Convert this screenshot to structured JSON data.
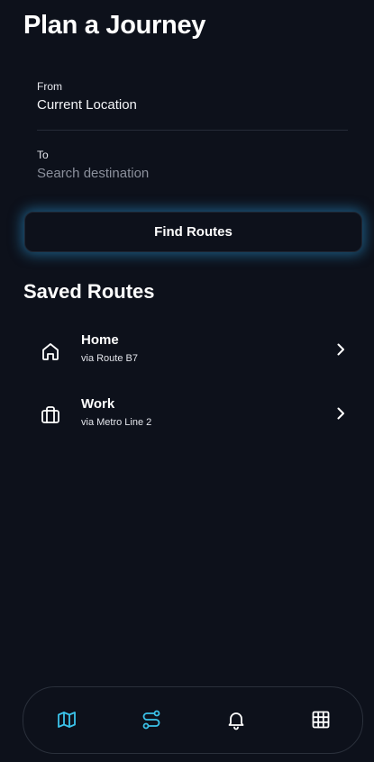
{
  "header": {
    "title": "Plan a Journey"
  },
  "form": {
    "from": {
      "label": "From",
      "value": "Current Location"
    },
    "to": {
      "label": "To",
      "value": "",
      "placeholder": "Search destination"
    },
    "submit_label": "Find Routes"
  },
  "saved_routes": {
    "title": "Saved Routes",
    "items": [
      {
        "name": "Home",
        "via": "via Route B7",
        "icon": "home-icon"
      },
      {
        "name": "Work",
        "via": "via Metro Line 2",
        "icon": "briefcase-icon"
      }
    ]
  },
  "bottom_nav": {
    "items": [
      {
        "icon": "map-icon",
        "active": true
      },
      {
        "icon": "route-icon",
        "active": true
      },
      {
        "icon": "bell-icon",
        "active": false
      },
      {
        "icon": "grid-icon",
        "active": false
      }
    ]
  },
  "colors": {
    "background": "#0d111b",
    "accent": "#3bc3ea",
    "glow": "#2996d2",
    "divider": "#262c38",
    "placeholder": "#8b909c"
  }
}
